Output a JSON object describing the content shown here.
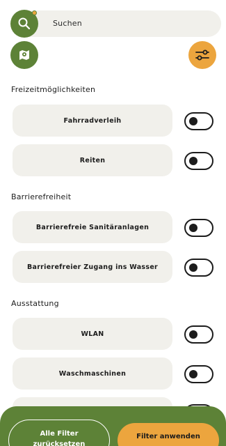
{
  "search": {
    "placeholder": "Suchen",
    "has_active_indicator": true
  },
  "icons": {
    "search": "search-icon",
    "map": "map-icon",
    "filter": "sliders-icon"
  },
  "colors": {
    "primary_green": "#5d8237",
    "accent_orange": "#eca53e",
    "card_bg": "#f1f0eb",
    "text": "#1c1c1c"
  },
  "sections": [
    {
      "title": "Freizeitmöglichkeiten",
      "options": [
        {
          "label": "Fahrradverleih",
          "enabled": false
        },
        {
          "label": "Reiten",
          "enabled": false
        }
      ]
    },
    {
      "title": "Barrierefreiheit",
      "options": [
        {
          "label": "Barrierefreie Sanitäranlagen",
          "enabled": false
        },
        {
          "label": "Barrierefreier Zugang ins Wasser",
          "enabled": false
        }
      ]
    },
    {
      "title": "Ausstattung",
      "options": [
        {
          "label": "WLAN",
          "enabled": false
        },
        {
          "label": "Waschmaschinen",
          "enabled": false
        }
      ]
    }
  ],
  "footer": {
    "reset_label_line1": "Alle Filter",
    "reset_label_line2": "zurücksetzen",
    "apply_label": "Filter anwenden"
  }
}
